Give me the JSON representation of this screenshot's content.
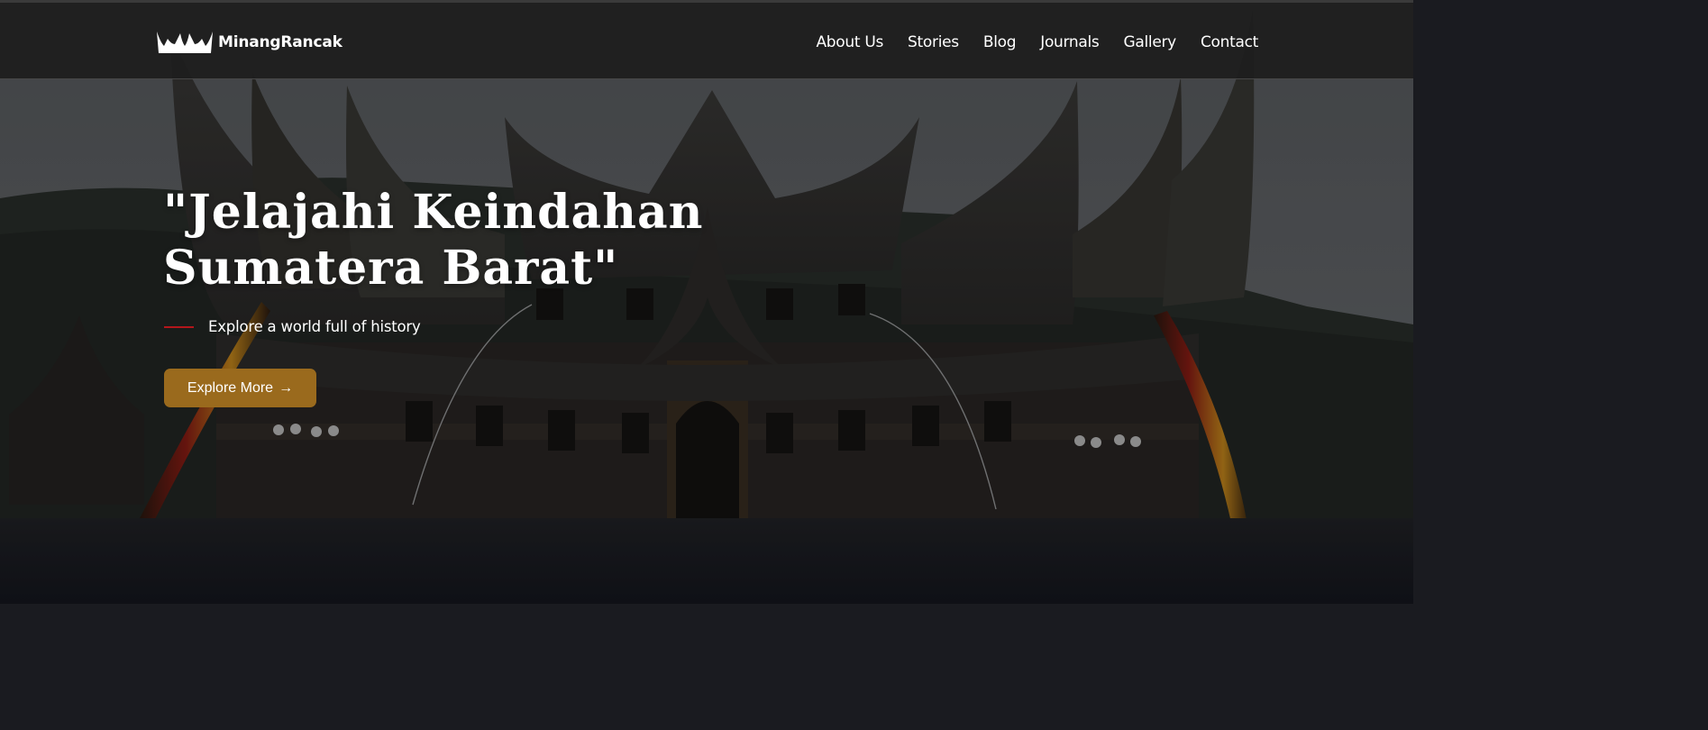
{
  "header": {
    "brand_name": "MinangRancak",
    "logo_icon": "rumah-gadang-roof-icon",
    "nav": [
      {
        "label": "About Us"
      },
      {
        "label": "Stories"
      },
      {
        "label": "Blog"
      },
      {
        "label": "Journals"
      },
      {
        "label": "Gallery"
      },
      {
        "label": "Contact"
      }
    ]
  },
  "hero": {
    "title_line1": "\"Jelajahi Keindahan",
    "title_line2": "Sumatera Barat\"",
    "tagline": "Explore a world full of history",
    "cta_label": "Explore More",
    "cta_icon": "arrow-right-icon",
    "background": "photo of a Rumah Gadang building"
  },
  "colors": {
    "navbar_bg": "#1e1e1e",
    "accent_line": "#b3161b",
    "cta_bg": "#9a6a1d",
    "text": "#ffffff"
  }
}
